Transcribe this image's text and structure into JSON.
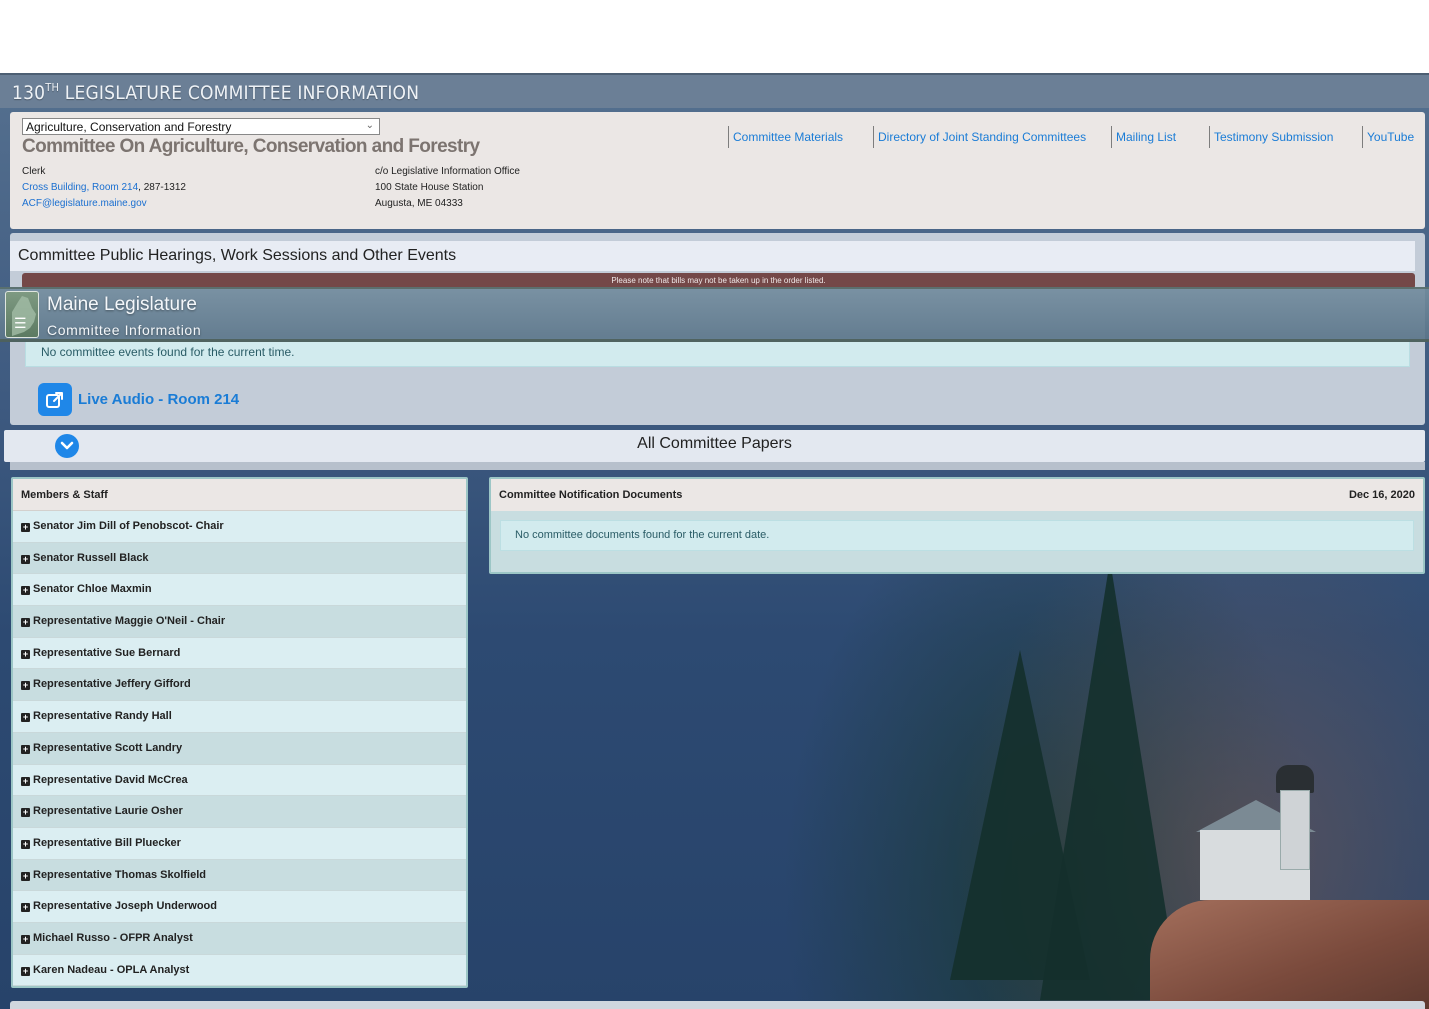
{
  "page_title": {
    "number": "130",
    "suffix": "TH",
    "rest": " LEGISLATURE COMMITTEE INFORMATION"
  },
  "committee_select": {
    "value": "Agriculture, Conservation and Forestry"
  },
  "committee_heading": "Committee On Agriculture, Conservation and Forestry",
  "contact": {
    "clerk_label": "Clerk",
    "location_link": "Cross Building, Room 214",
    "phone": ", 287-1312",
    "email": "ACF@legislature.maine.gov",
    "address_line1": "c/o Legislative Information Office",
    "address_line2": "100 State House Station",
    "address_line3": "Augusta, ME 04333"
  },
  "top_links": [
    "Committee Materials",
    "Directory of Joint Standing Committees",
    "Mailing List",
    "Testimony Submission",
    "YouTube"
  ],
  "events": {
    "heading": "Committee Public Hearings, Work Sessions and Other Events",
    "notice": "Please note that bills may not be taken up in the order listed.",
    "empty_message": "No committee events found for the current time.",
    "live_audio_label": "Live Audio - Room 214"
  },
  "site_header": {
    "name": "Maine Legislature",
    "subtitle": "Committee Information"
  },
  "papers": {
    "label": "All Committee Papers"
  },
  "members_panel": {
    "heading": "Members & Staff",
    "members": [
      "Senator Jim Dill of Penobscot- Chair",
      "Senator Russell Black",
      "Senator Chloe Maxmin",
      "Representative Maggie O'Neil - Chair",
      "Representative Sue Bernard",
      "Representative Jeffery Gifford",
      "Representative Randy Hall",
      "Representative Scott Landry",
      "Representative David McCrea",
      "Representative Laurie Osher",
      "Representative Bill Pluecker",
      "Representative Thomas Skolfield",
      "Representative Joseph Underwood",
      "Michael Russo - OFPR Analyst",
      "Karen Nadeau - OPLA Analyst"
    ]
  },
  "docs_panel": {
    "heading": "Committee Notification Documents",
    "date": "Dec 16, 2020",
    "empty_message": "No committee documents found for the current date."
  },
  "colors": {
    "link": "#1a7cd6",
    "accent_blue": "#1f87e8",
    "notice_bar": "#744848",
    "title_band": "#6b7f96"
  }
}
